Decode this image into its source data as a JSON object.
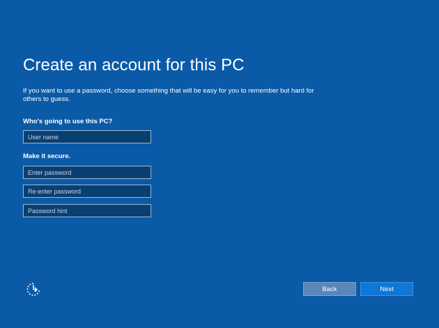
{
  "page": {
    "title": "Create an account for this PC",
    "description": "If you want to use a password, choose something that will be easy for you to remember but hard for others to guess."
  },
  "user_section": {
    "label": "Who's going to use this PC?",
    "username_placeholder": "User name"
  },
  "password_section": {
    "label": "Make it secure.",
    "password_placeholder": "Enter password",
    "reenter_placeholder": "Re-enter password",
    "hint_placeholder": "Password hint"
  },
  "footer": {
    "ease_of_access_icon": "ease-of-access-icon",
    "back_label": "Back",
    "next_label": "Next"
  },
  "colors": {
    "background": "#0b5aa7",
    "next_button": "#0f78d7",
    "back_button": "#5a86ba",
    "field_bg": "#0a3f72"
  }
}
